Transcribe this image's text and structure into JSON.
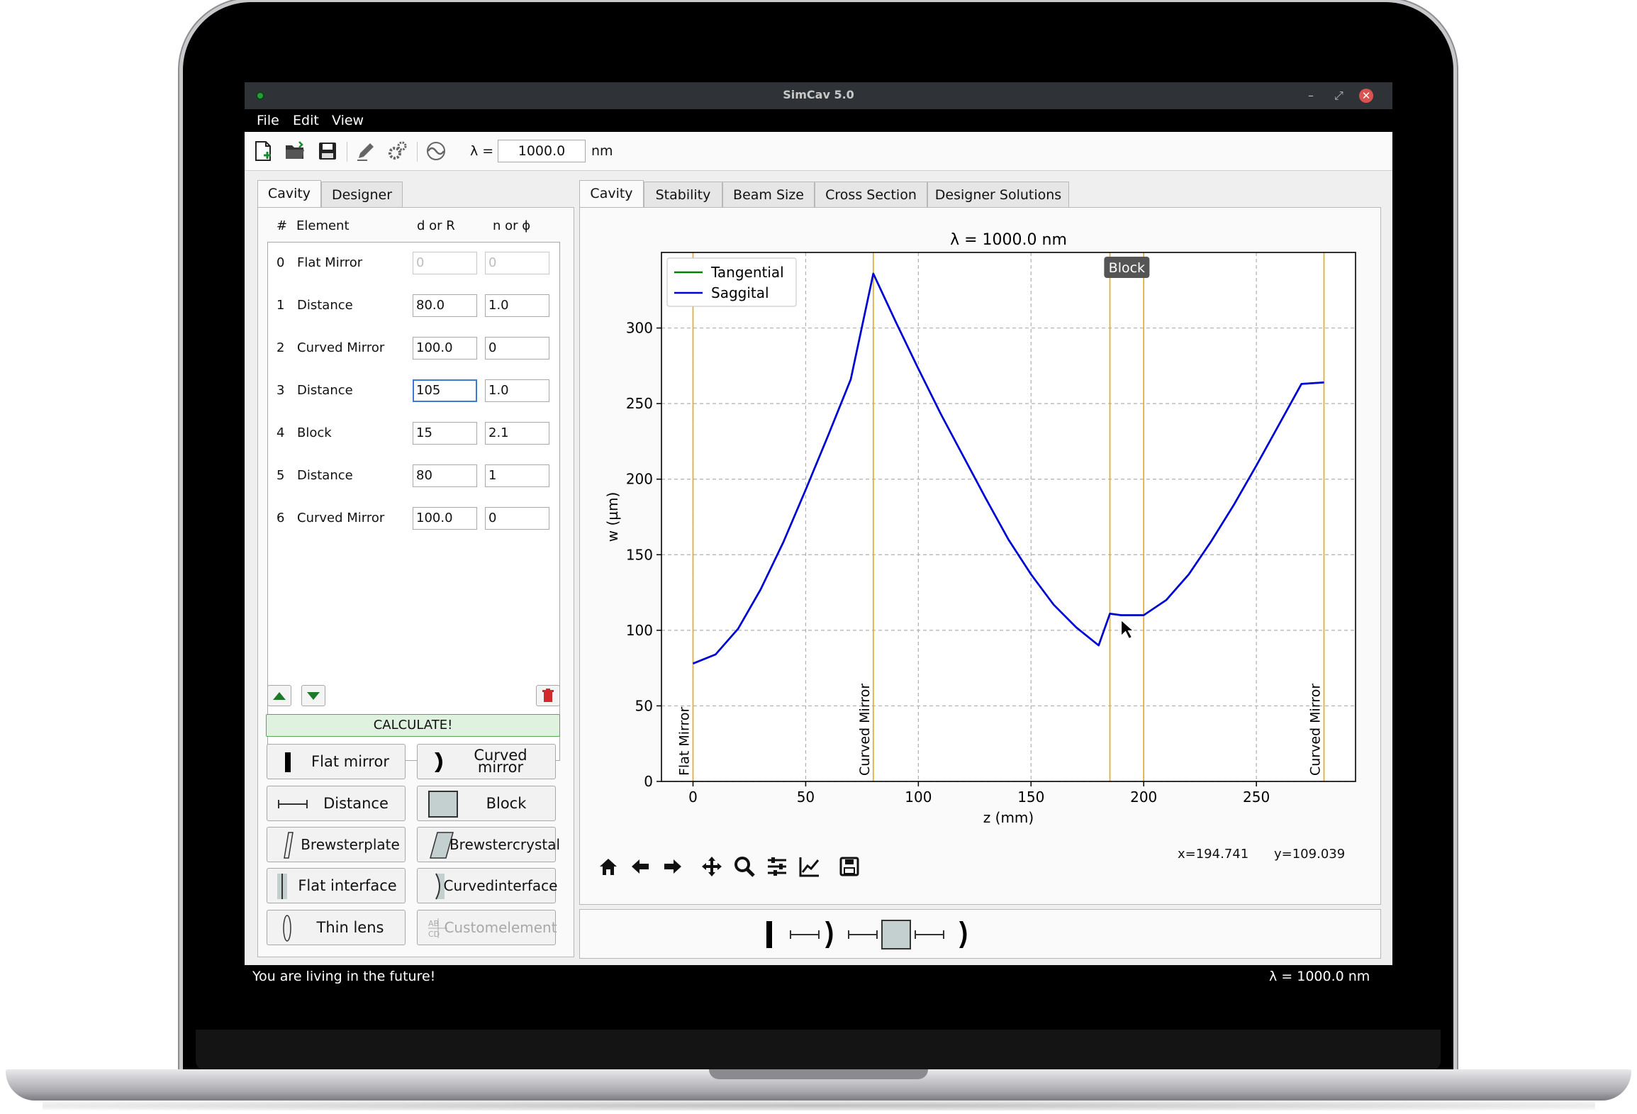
{
  "window": {
    "title": "SimCav 5.0"
  },
  "menu": [
    "File",
    "Edit",
    "View"
  ],
  "toolbar": {
    "lambda_label": "λ =",
    "lambda_value": "1000.0",
    "lambda_unit": "nm"
  },
  "left_tabs": [
    {
      "label": "Cavity",
      "active": true
    },
    {
      "label": "Designer",
      "active": false
    }
  ],
  "element_table": {
    "headers": {
      "index": "#",
      "element": "Element",
      "d_or_r": "d or R",
      "n_or_phi": "n or ϕ"
    },
    "rows": [
      {
        "index": "0",
        "element": "Flat Mirror",
        "d": "0",
        "n": "0"
      },
      {
        "index": "1",
        "element": "Distance",
        "d": "80.0",
        "n": "1.0"
      },
      {
        "index": "2",
        "element": "Curved Mirror",
        "d": "100.0",
        "n": "0"
      },
      {
        "index": "3",
        "element": "Distance",
        "d": "105",
        "n": "1.0"
      },
      {
        "index": "4",
        "element": "Block",
        "d": "15",
        "n": "2.1"
      },
      {
        "index": "5",
        "element": "Distance",
        "d": "80",
        "n": "1"
      },
      {
        "index": "6",
        "element": "Curved Mirror",
        "d": "100.0",
        "n": "0"
      }
    ]
  },
  "calculate_label": "CALCULATE!",
  "element_buttons": {
    "flat_mirror": "Flat mirror",
    "curved_mirror": "Curved mirror",
    "distance": "Distance",
    "block": "Block",
    "brewster_plate_1": "Brewster",
    "brewster_plate_2": "plate",
    "brewster_crystal_1": "Brewster",
    "brewster_crystal_2": "crystal",
    "flat_interface": "Flat interface",
    "curved_interface_1": "Curved",
    "curved_interface_2": "interface",
    "thin_lens": "Thin lens",
    "custom_element_1": "Custom",
    "custom_element_2": "element"
  },
  "right_tabs": [
    {
      "label": "Cavity",
      "active": true
    },
    {
      "label": "Stability",
      "active": false
    },
    {
      "label": "Beam Size",
      "active": false
    },
    {
      "label": "Cross Section",
      "active": false
    },
    {
      "label": "Designer Solutions",
      "active": false
    }
  ],
  "cursor": {
    "x": "x=194.741",
    "y": "y=109.039"
  },
  "status": {
    "message": "You are living in the future!",
    "lambda": "λ = 1000.0 nm"
  },
  "colors": {
    "tangential": "#008000",
    "saggital": "#0000dd",
    "element_line": "#f0a800",
    "calc_bg": "#dff2df",
    "status_bg": "#000000"
  },
  "chart_data": {
    "type": "line",
    "title": "λ = 1000.0 nm",
    "xlabel": "z (mm)",
    "ylabel": "w (µm)",
    "xlim": [
      -14,
      294
    ],
    "ylim": [
      0,
      350
    ],
    "xticks": [
      0,
      50,
      100,
      150,
      200,
      250
    ],
    "yticks": [
      0,
      50,
      100,
      150,
      200,
      250,
      300
    ],
    "grid": true,
    "legend": "top-left",
    "series": [
      {
        "name": "Tangential",
        "x": [
          0,
          10,
          20,
          30,
          40,
          50,
          60,
          70,
          80,
          90,
          100,
          110,
          120,
          130,
          140,
          150,
          160,
          170,
          180,
          185,
          190,
          195,
          200,
          210,
          220,
          230,
          240,
          250,
          260,
          270,
          280
        ],
        "y": [
          78,
          84,
          101,
          127,
          158,
          193,
          229,
          266,
          336,
          304,
          273,
          243,
          215,
          187,
          160,
          137,
          117,
          102,
          90,
          111,
          110,
          110,
          110,
          120,
          137,
          159,
          183,
          209,
          236,
          263,
          264
        ]
      },
      {
        "name": "Saggital",
        "x": [
          0,
          10,
          20,
          30,
          40,
          50,
          60,
          70,
          80,
          90,
          100,
          110,
          120,
          130,
          140,
          150,
          160,
          170,
          180,
          185,
          190,
          195,
          200,
          210,
          220,
          230,
          240,
          250,
          260,
          270,
          280
        ],
        "y": [
          78,
          84,
          101,
          127,
          158,
          193,
          229,
          266,
          336,
          304,
          273,
          243,
          215,
          187,
          160,
          137,
          117,
          102,
          90,
          111,
          110,
          110,
          110,
          120,
          137,
          159,
          183,
          209,
          236,
          263,
          264
        ]
      }
    ],
    "element_markers": [
      {
        "z": 0,
        "label": "Flat Mirror"
      },
      {
        "z": 80,
        "label": "Curved Mirror"
      },
      {
        "z": 185,
        "label": ""
      },
      {
        "z": 200,
        "label": ""
      },
      {
        "z": 280,
        "label": "Curved Mirror"
      }
    ],
    "region_label": {
      "text": "Block",
      "z": 192.5
    }
  }
}
